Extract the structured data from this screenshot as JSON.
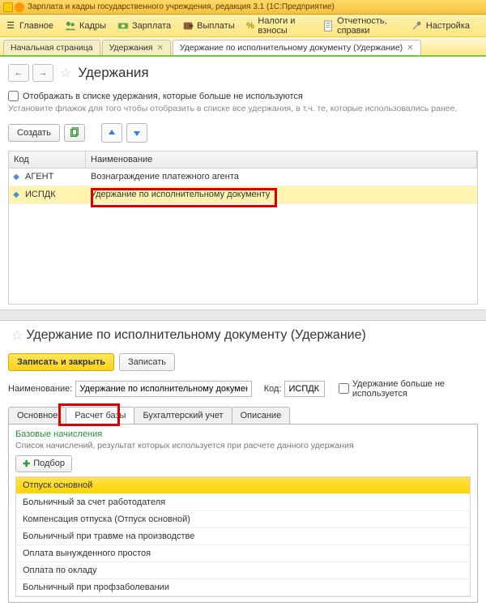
{
  "app_title": "Зарплата и кадры государственного учреждения, редакция 3.1   (1С:Предприятие)",
  "main_menu": {
    "home": "Главное",
    "personnel": "Кадры",
    "salary": "Зарплата",
    "payments": "Выплаты",
    "taxes": "Налоги и взносы",
    "reports": "Отчетность, справки",
    "settings": "Настройка"
  },
  "tabs": {
    "start": "Начальная страница",
    "t1": "Удержания",
    "t2": "Удержание по исполнительному документу (Удержание)"
  },
  "upper": {
    "title": "Удержания",
    "show_unused_label": "Отображать в списке удержания, которые больше не используются",
    "show_unused_hint": "Установите флажок для того чтобы отобразить в списке все удержания, в т.ч. те, которые использовались ранее.",
    "create_btn": "Создать",
    "col_code": "Код",
    "col_name": "Наименование",
    "rows": [
      {
        "code": "АГЕНТ",
        "name": "Вознаграждение платежного агента"
      },
      {
        "code": "ИСПДК",
        "name": "Удержание по исполнительному документу"
      }
    ]
  },
  "lower": {
    "title": "Удержание по исполнительному документу (Удержание)",
    "save_close": "Записать и закрыть",
    "save": "Записать",
    "name_label": "Наименование:",
    "name_value": "Удержание по исполнительному документу",
    "code_label": "Код:",
    "code_value": "ИСПДК",
    "unused_label": "Удержание больше не используется",
    "tabs": {
      "main": "Основное",
      "base": "Расчет базы",
      "accounting": "Бухгалтерский учет",
      "desc": "Описание"
    },
    "base_heading": "Базовые начисления",
    "base_hint": "Список начислений, результат которых используется при расчете данного удержания",
    "pick": "Подбор",
    "accruals": [
      "Отпуск основной",
      "Больничный за счет работодателя",
      "Компенсация отпуска (Отпуск основной)",
      "Больничный при травме на производстве",
      "Оплата вынужденного простоя",
      "Оплата по окладу",
      "Больничный при профзаболевании"
    ]
  }
}
